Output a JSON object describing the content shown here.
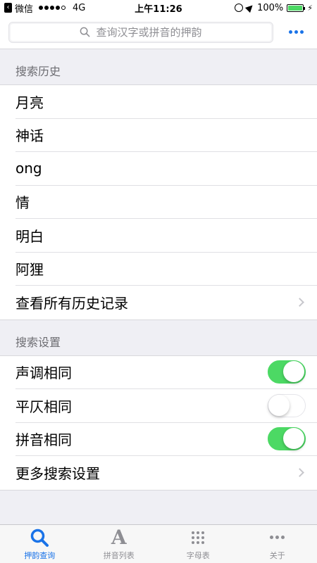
{
  "status_bar": {
    "carrier_app": "微信",
    "network": "4G",
    "time": "上午11:26",
    "battery": "100%",
    "battery_level": 1.0
  },
  "search": {
    "placeholder": "查询汉字或拼音的押韵",
    "more_icon": "more-dots-icon"
  },
  "history": {
    "title": "搜索历史",
    "items": [
      {
        "label": "月亮"
      },
      {
        "label": "神话"
      },
      {
        "label": "ong"
      },
      {
        "label": "情"
      },
      {
        "label": "明白"
      },
      {
        "label": "阿狸"
      }
    ],
    "view_all": "查看所有历史记录"
  },
  "settings": {
    "title": "搜索设置",
    "toggles": [
      {
        "label": "声调相同",
        "on": true
      },
      {
        "label": "平仄相同",
        "on": false
      },
      {
        "label": "拼音相同",
        "on": true
      }
    ],
    "more": "更多搜索设置"
  },
  "tabs": [
    {
      "label": "押韵查询",
      "icon": "search-icon",
      "active": true
    },
    {
      "label": "拼音列表",
      "icon": "letter-a-icon",
      "active": false
    },
    {
      "label": "字母表",
      "icon": "grid-icon",
      "active": false
    },
    {
      "label": "关于",
      "icon": "more-icon",
      "active": false
    }
  ],
  "colors": {
    "accent": "#1a73e8",
    "toggle_on": "#4cd964",
    "background": "#efeff4"
  }
}
